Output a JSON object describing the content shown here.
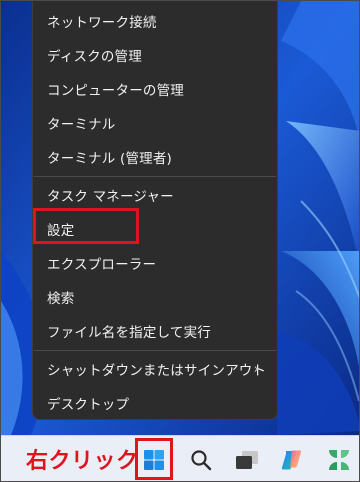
{
  "context_menu": {
    "items": [
      {
        "label": "ネットワーク接続"
      },
      {
        "label": "ディスクの管理"
      },
      {
        "label": "コンピューターの管理"
      },
      {
        "label": "ターミナル"
      },
      {
        "label": "ターミナル (管理者)"
      },
      {
        "label": "タスク マネージャー"
      },
      {
        "label": "設定"
      },
      {
        "label": "エクスプローラー"
      },
      {
        "label": "検索"
      },
      {
        "label": "ファイル名を指定して実行"
      },
      {
        "label": "シャットダウンまたはサインアウト",
        "submenu_indicator": "›"
      },
      {
        "label": "デスクトップ"
      }
    ],
    "highlighted_item": "設定"
  },
  "annotation": {
    "text": "右クリック",
    "color": "#e0141c"
  },
  "taskbar": {
    "icons": [
      "windows-start-icon",
      "search-icon",
      "task-view-icon",
      "copilot-icon",
      "widgets-icon"
    ],
    "highlighted_icon": "windows-start-icon"
  },
  "colors": {
    "menu_background": "#2c2c2c",
    "menu_text": "#f2f2f2",
    "highlight": "#e0141c",
    "taskbar_background": "#e9eef7",
    "wallpaper": "#0a3aa8"
  }
}
